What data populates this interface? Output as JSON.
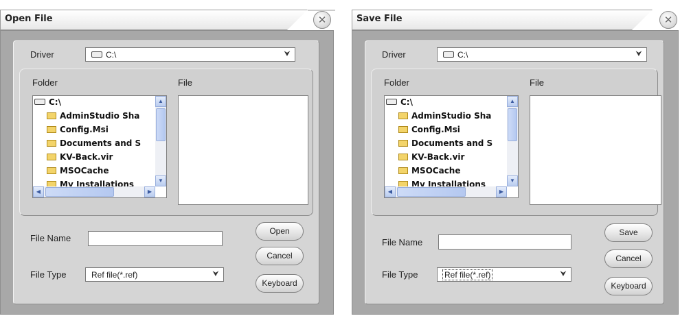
{
  "open_dialog": {
    "title": "Open File",
    "driver_label": "Driver",
    "driver_value": "C:\\",
    "folder_label": "Folder",
    "file_label": "File",
    "tree_items": [
      "C:\\",
      "AdminStudio Sha",
      "Config.Msi",
      "Documents and S",
      "KV-Back.vir",
      "MSOCache",
      "My Installations"
    ],
    "file_name_label": "File Name",
    "file_name_value": "",
    "file_type_label": "File Type",
    "file_type_value": "Ref file(*.ref)",
    "buttons": {
      "primary": "Open",
      "cancel": "Cancel",
      "keyboard": "Keyboard"
    }
  },
  "save_dialog": {
    "title": "Save File",
    "driver_label": "Driver",
    "driver_value": "C:\\",
    "folder_label": "Folder",
    "file_label": "File",
    "tree_items": [
      "C:\\",
      "AdminStudio Sha",
      "Config.Msi",
      "Documents and S",
      "KV-Back.vir",
      "MSOCache",
      "My Installations"
    ],
    "file_name_label": "File Name",
    "file_name_value": "",
    "file_type_label": "File Type",
    "file_type_value": "Ref file(*.ref)",
    "buttons": {
      "primary": "Save",
      "cancel": "Cancel",
      "keyboard": "Keyboard"
    }
  },
  "icons": {
    "close": "close-circle-icon",
    "dropdown": "double-chevron-down-icon",
    "drive": "drive-icon",
    "folder": "folder-icon"
  }
}
